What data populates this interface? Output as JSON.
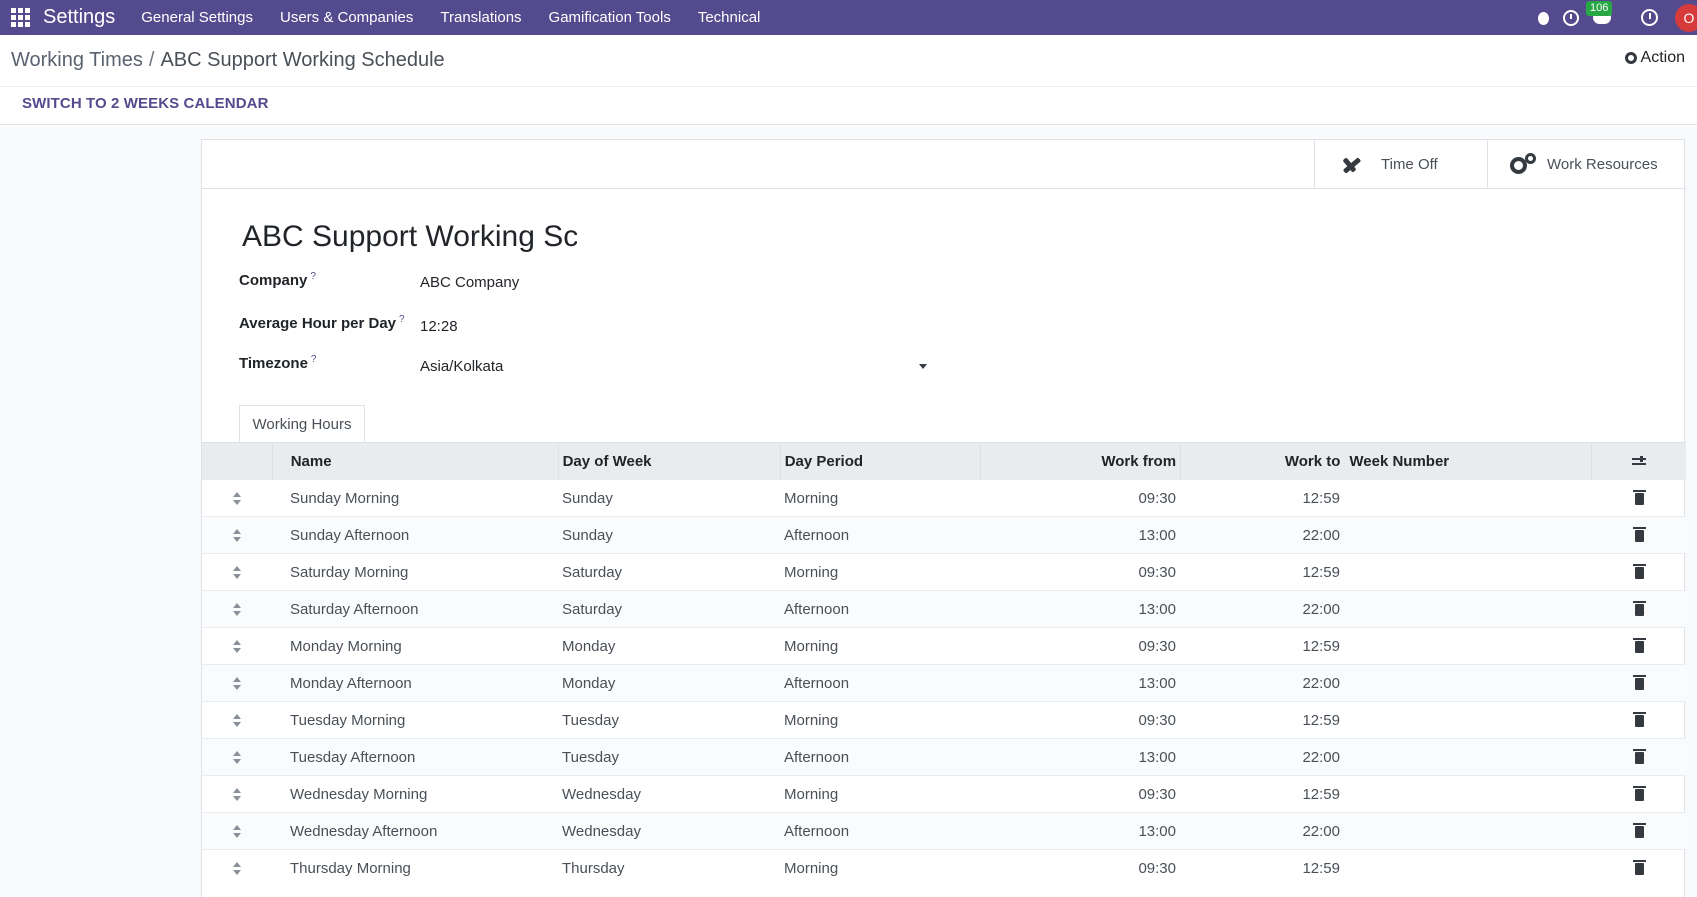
{
  "navbar": {
    "brand": "Settings",
    "menus": [
      "General Settings",
      "Users & Companies",
      "Translations",
      "Gamification Tools",
      "Technical"
    ],
    "message_count": "106",
    "avatar_initial": "O"
  },
  "control_panel": {
    "breadcrumb_parent": "Working Times",
    "breadcrumb_separator": "/",
    "breadcrumb_current": "ABC Support Working Schedule",
    "action_label": "Action",
    "switch_button": "SWITCH TO 2 WEEKS CALENDAR"
  },
  "button_box": {
    "time_off": "Time Off",
    "work_resources": "Work Resources"
  },
  "form": {
    "title": "ABC Support Working Sch",
    "company_label": "Company",
    "company_value": "ABC Company",
    "avg_hour_label": "Average Hour per Day",
    "avg_hour_value": "12:28",
    "timezone_label": "Timezone",
    "timezone_value": "Asia/Kolkata",
    "help_mark": "?"
  },
  "tab": {
    "label": "Working Hours"
  },
  "table": {
    "headers": {
      "name": "Name",
      "day": "Day of Week",
      "period": "Day Period",
      "from": "Work from",
      "to": "Work to",
      "week": "Week Number"
    },
    "rows": [
      {
        "name": "Sunday Morning",
        "day": "Sunday",
        "period": "Morning",
        "from": "09:30",
        "to": "12:59"
      },
      {
        "name": "Sunday Afternoon",
        "day": "Sunday",
        "period": "Afternoon",
        "from": "13:00",
        "to": "22:00"
      },
      {
        "name": "Saturday Morning",
        "day": "Saturday",
        "period": "Morning",
        "from": "09:30",
        "to": "12:59"
      },
      {
        "name": "Saturday Afternoon",
        "day": "Saturday",
        "period": "Afternoon",
        "from": "13:00",
        "to": "22:00"
      },
      {
        "name": "Monday Morning",
        "day": "Monday",
        "period": "Morning",
        "from": "09:30",
        "to": "12:59"
      },
      {
        "name": "Monday Afternoon",
        "day": "Monday",
        "period": "Afternoon",
        "from": "13:00",
        "to": "22:00"
      },
      {
        "name": "Tuesday Morning",
        "day": "Tuesday",
        "period": "Morning",
        "from": "09:30",
        "to": "12:59"
      },
      {
        "name": "Tuesday Afternoon",
        "day": "Tuesday",
        "period": "Afternoon",
        "from": "13:00",
        "to": "22:00"
      },
      {
        "name": "Wednesday Morning",
        "day": "Wednesday",
        "period": "Morning",
        "from": "09:30",
        "to": "12:59"
      },
      {
        "name": "Wednesday Afternoon",
        "day": "Wednesday",
        "period": "Afternoon",
        "from": "13:00",
        "to": "22:00"
      },
      {
        "name": "Thursday Morning",
        "day": "Thursday",
        "period": "Morning",
        "from": "09:30",
        "to": "12:59"
      }
    ]
  },
  "colors": {
    "navbar": "#544b8e",
    "badge": "#28a745",
    "avatar": "#d63a3a"
  }
}
